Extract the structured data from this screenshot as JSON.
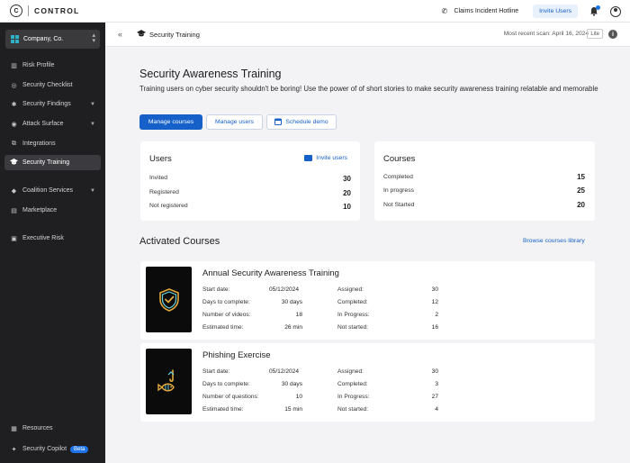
{
  "topbar": {
    "logo_text": "C",
    "brand": "CONTROL",
    "hotline": "Claims Incident Hotline",
    "invite": "Invite Users"
  },
  "sidebar": {
    "company": "Company, Co.",
    "items": [
      {
        "label": "Risk Profile",
        "icon": "bar-chart-icon",
        "glyph": "▥"
      },
      {
        "label": "Security Checklist",
        "icon": "check-circle-icon",
        "glyph": "◎"
      },
      {
        "label": "Security Findings",
        "icon": "bug-icon",
        "glyph": "✱"
      },
      {
        "label": "Attack Surface",
        "icon": "target-icon",
        "glyph": "◉"
      },
      {
        "label": "Integrations",
        "icon": "integrations-icon",
        "glyph": "⧉"
      },
      {
        "label": "Security Training",
        "icon": "graduation-cap-icon",
        "glyph": "🎓"
      },
      {
        "label": "Coalition Services",
        "icon": "diamond-icon",
        "glyph": "◆"
      },
      {
        "label": "Marketplace",
        "icon": "store-icon",
        "glyph": "▤"
      },
      {
        "label": "Executive Risk",
        "icon": "briefcase-icon",
        "glyph": "▣"
      },
      {
        "label": "Resources",
        "icon": "book-icon",
        "glyph": "▦"
      },
      {
        "label": "Security Copilot",
        "icon": "lightbulb-icon",
        "glyph": "✦"
      }
    ],
    "copilot_badge": "Beta"
  },
  "header": {
    "breadcrumb": "Security Training",
    "scan": "Most recent scan: April 16, 2024",
    "mode": "Lite"
  },
  "main": {
    "title": "Security Awareness Training",
    "description": "Training users on cyber security shouldn't be boring! Use the power of of short stories to make security awareness training relatable and memorable",
    "buttons": {
      "manage_courses": "Manage courses",
      "manage_users": "Manage users",
      "schedule_demo": "Schedule demo"
    }
  },
  "users_card": {
    "title": "Users",
    "invite": "Invite users",
    "rows": [
      {
        "label": "Invited",
        "value": "30"
      },
      {
        "label": "Registered",
        "value": "20"
      },
      {
        "label": "Not registered",
        "value": "10"
      }
    ]
  },
  "courses_card": {
    "title": "Courses",
    "rows": [
      {
        "label": "Completed",
        "value": "15"
      },
      {
        "label": "In progress",
        "value": "25"
      },
      {
        "label": "Not Started",
        "value": "20"
      }
    ]
  },
  "activated": {
    "title": "Activated Courses",
    "browse": "Browse courses library",
    "courses": [
      {
        "name": "Annual Security Awareness Training",
        "left": [
          {
            "label": "Start date:",
            "value": "05/12/2024"
          },
          {
            "label": "Days to complete:",
            "value": "30 days"
          },
          {
            "label": "Number of videos:",
            "value": "18"
          },
          {
            "label": "Estimated time:",
            "value": "26 min"
          }
        ],
        "right": [
          {
            "label": "Assigned:",
            "value": "30"
          },
          {
            "label": "Completed:",
            "value": "12"
          },
          {
            "label": "In Progress:",
            "value": "2"
          },
          {
            "label": "Not started:",
            "value": "16"
          }
        ]
      },
      {
        "name": "Phishing Exercise",
        "left": [
          {
            "label": "Start date:",
            "value": "05/12/2024"
          },
          {
            "label": "Days to complete:",
            "value": "30 days"
          },
          {
            "label": "Number of questions:",
            "value": "10"
          },
          {
            "label": "Estimated time:",
            "value": "15 min"
          }
        ],
        "right": [
          {
            "label": "Assigned:",
            "value": "30"
          },
          {
            "label": "Completed:",
            "value": "3"
          },
          {
            "label": "In Progress:",
            "value": "27"
          },
          {
            "label": "Not started:",
            "value": "4"
          }
        ]
      }
    ]
  },
  "colors": {
    "primary": "#1660c9",
    "sidebar_bg": "#1f1f21",
    "accent_teal": "#2fb2c7",
    "thumb_gold": "#e2a93a",
    "thumb_cyan": "#6ad0e0"
  }
}
